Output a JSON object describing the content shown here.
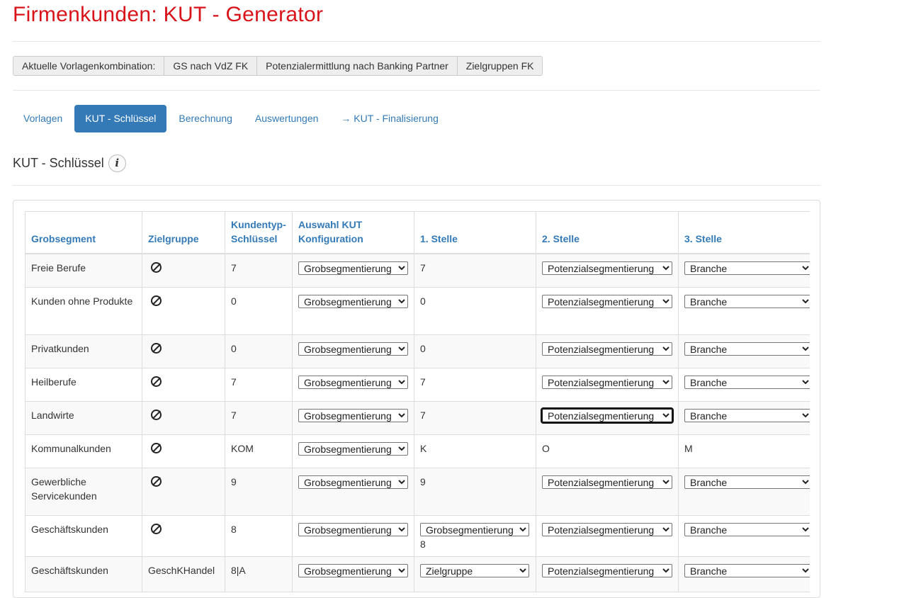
{
  "page": {
    "title": "Firmenkunden: KUT - Generator"
  },
  "combination": {
    "label": "Aktuelle Vorlagenkombination:",
    "items": [
      "GS nach VdZ FK",
      "Potenzialermittlung nach Banking Partner",
      "Zielgruppen FK"
    ]
  },
  "tabs": [
    {
      "label": "Vorlagen"
    },
    {
      "label": "KUT - Schlüssel"
    },
    {
      "label": "Berechnung"
    },
    {
      "label": "Auswertungen"
    },
    {
      "label": "→ KUT - Finalisierung"
    }
  ],
  "section": {
    "title": "KUT - Schlüssel",
    "info_icon": "info-icon"
  },
  "table": {
    "headers": {
      "grobsegment": "Grobsegment",
      "zielgruppe": "Zielgruppe",
      "schluessel": "Kundentyp-Schlüssel",
      "auswahl": "Auswahl KUT Konfiguration",
      "stelle1": "1. Stelle",
      "stelle2": "2. Stelle",
      "stelle3": "3. Stelle"
    },
    "rows": [
      {
        "grobsegment": "Freie Berufe",
        "zielgruppe": "",
        "schluessel": "7",
        "auswahl": "Grobsegmentierung",
        "stelle1": "7",
        "stelle2": "Potenzialsegmentierung",
        "stelle3": "Branche"
      },
      {
        "grobsegment": "Kunden ohne Produkte",
        "zielgruppe": "",
        "schluessel": "0",
        "auswahl": "Grobsegmentierung",
        "stelle1": "0",
        "stelle2": "Potenzialsegmentierung",
        "stelle3": "Branche"
      },
      {
        "grobsegment": "Privatkunden",
        "zielgruppe": "",
        "schluessel": "0",
        "auswahl": "Grobsegmentierung",
        "stelle1": "0",
        "stelle2": "Potenzialsegmentierung",
        "stelle3": "Branche"
      },
      {
        "grobsegment": "Heilberufe",
        "zielgruppe": "",
        "schluessel": "7",
        "auswahl": "Grobsegmentierung",
        "stelle1": "7",
        "stelle2": "Potenzialsegmentierung",
        "stelle3": "Branche"
      },
      {
        "grobsegment": "Landwirte",
        "zielgruppe": "",
        "schluessel": "7",
        "auswahl": "Grobsegmentierung",
        "stelle1": "7",
        "stelle2": "Potenzialsegmentierung",
        "stelle3": "Branche"
      },
      {
        "grobsegment": "Kommunalkunden",
        "zielgruppe": "",
        "schluessel": "KOM",
        "auswahl": "Grobsegmentierung",
        "stelle1": "K",
        "stelle2": "O",
        "stelle3": "M"
      },
      {
        "grobsegment": "Gewerbliche Servicekunden",
        "zielgruppe": "",
        "schluessel": "9",
        "auswahl": "Grobsegmentierung",
        "stelle1": "9",
        "stelle2": "Potenzialsegmentierung",
        "stelle3": "Branche"
      },
      {
        "grobsegment": "Geschäftskunden",
        "zielgruppe": "",
        "schluessel": "8",
        "auswahl": "Grobsegmentierung",
        "stelle1_select": "Grobsegmentierung",
        "stelle1": "8",
        "stelle2": "Potenzialsegmentierung",
        "stelle3": "Branche"
      },
      {
        "grobsegment": "Geschäftskunden",
        "zielgruppe": "GeschKHandel",
        "schluessel": "8|A",
        "auswahl": "Grobsegmentierung",
        "stelle1_select": "Zielgruppe",
        "stelle1": "",
        "stelle2": "Potenzialsegmentierung",
        "stelle3": "Branche"
      }
    ]
  }
}
